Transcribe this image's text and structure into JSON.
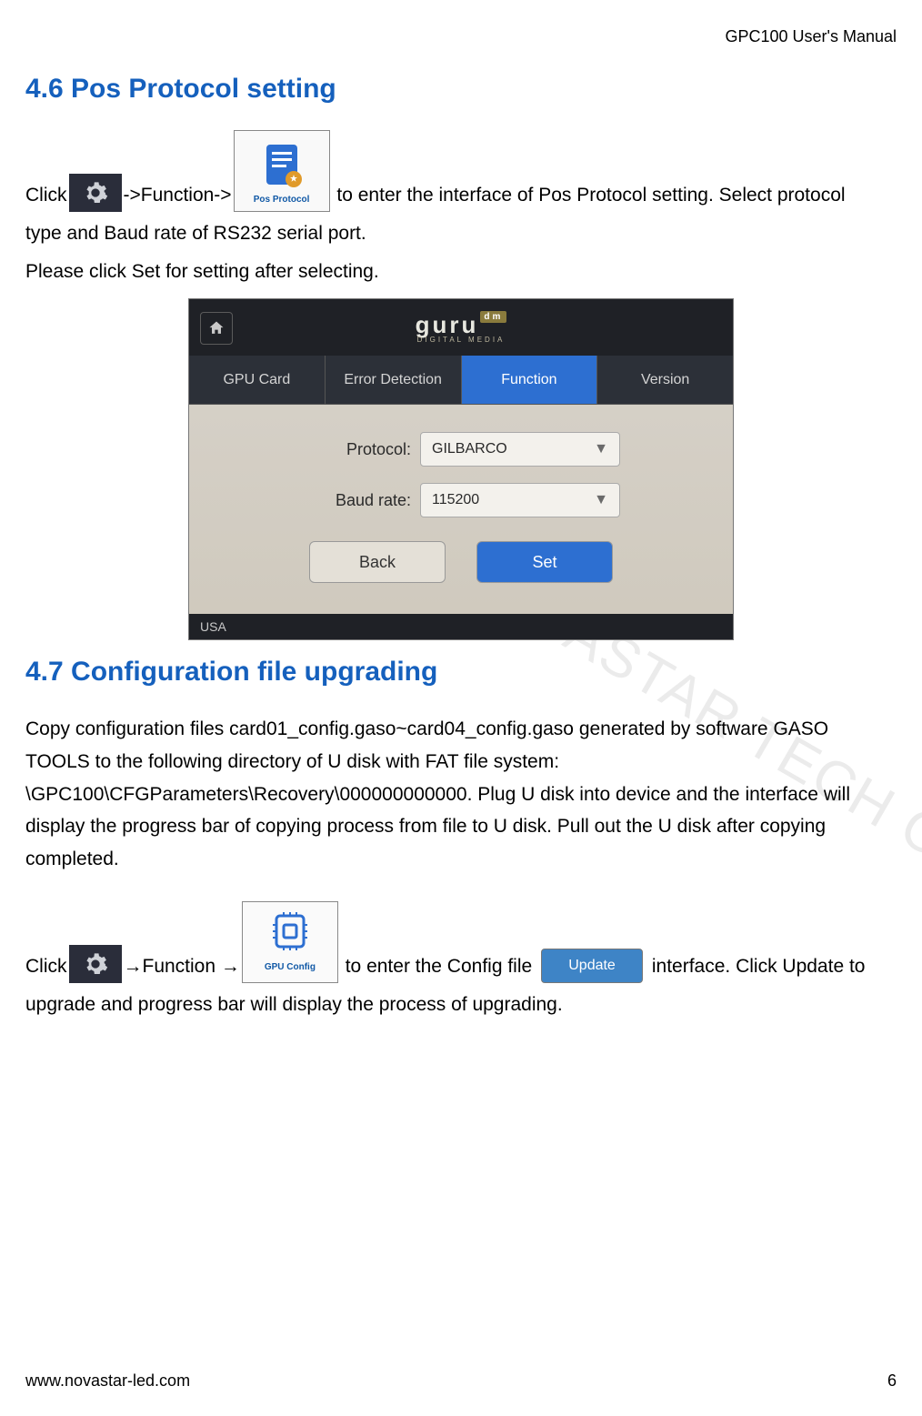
{
  "header": {
    "doc_title": "GPC100 User's Manual"
  },
  "section46": {
    "heading": "4.6 Pos Protocol setting",
    "line1_a": "Click",
    "line1_b": "->Function->",
    "line1_c": " to enter the interface of Pos Protocol setting. Select protocol",
    "line2": "type and Baud rate of RS232 serial port.",
    "line3": "Please click Set for setting after selecting.",
    "icon_pos_label": "Pos Protocol"
  },
  "screenshot": {
    "brand": "guru",
    "brand_badge": "dm",
    "brand_sub": "DIGITAL MEDIA",
    "tabs": {
      "gpu_card": "GPU Card",
      "error_detection": "Error Detection",
      "function": "Function",
      "version": "Version"
    },
    "protocol_label": "Protocol:",
    "protocol_value": "GILBARCO",
    "baud_label": "Baud rate:",
    "baud_value": "115200",
    "back_btn": "Back",
    "set_btn": "Set",
    "footer_region": "USA"
  },
  "section47": {
    "heading": "4.7 Configuration file upgrading",
    "para_a": "Copy configuration files card01_config.gaso~card04_config.gaso generated by software GASO TOOLS to the following directory of U disk with FAT file system: \\GPC100\\CFGParameters\\Recovery\\000000000000. Plug U disk into device and the interface will display the progress bar of copying process from file to U disk. Pull out the U disk after copying completed.",
    "line_a": "Click",
    "line_b": "→Function →",
    "gpu_config_label": "GPU Config",
    "line_c": " to enter the Config file ",
    "update_btn": "Update",
    "line_d": " interface. Click Update to",
    "line_e": "upgrade and progress bar will display the process of upgrading."
  },
  "watermark": "XI'AN NOVASTAR TECH CO., LTD",
  "footer": {
    "url": "www.novastar-led.com",
    "page": "6"
  }
}
